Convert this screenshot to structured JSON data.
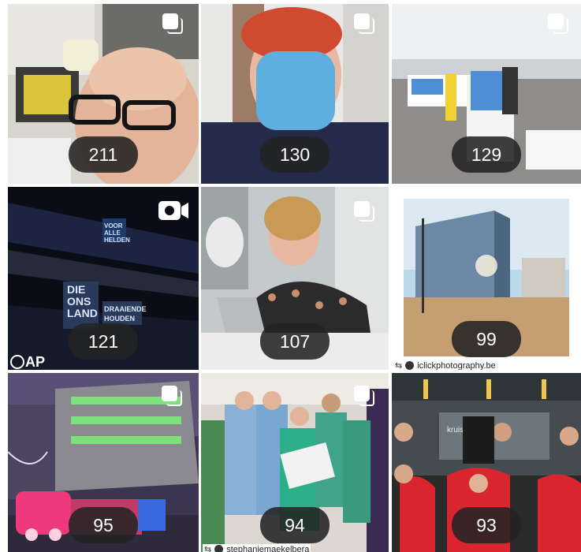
{
  "posts": [
    {
      "count": "211",
      "multi": true
    },
    {
      "count": "130",
      "multi": true
    },
    {
      "count": "129",
      "multi": true
    },
    {
      "count": "121",
      "video": true,
      "sign_text": [
        "VOOR",
        "ALLE",
        "HELDEN",
        "DIE",
        "ONS",
        "LAND",
        "DRAAIENDE",
        "HOUDEN"
      ],
      "logo_text": "AP"
    },
    {
      "count": "107",
      "multi": true
    },
    {
      "count": "99",
      "credit": "iclickphotography.be"
    },
    {
      "count": "95",
      "multi": true
    },
    {
      "count": "94",
      "multi": true,
      "credit": "stephaniemaekelbera"
    },
    {
      "count": "93",
      "sign_text": "kruis - bo"
    }
  ],
  "icons": {
    "multi": "carousel-icon",
    "video": "video-icon",
    "repost": "repost-icon"
  },
  "colors": {
    "badge_bg": "#232323",
    "badge_text": "#ffffff"
  }
}
